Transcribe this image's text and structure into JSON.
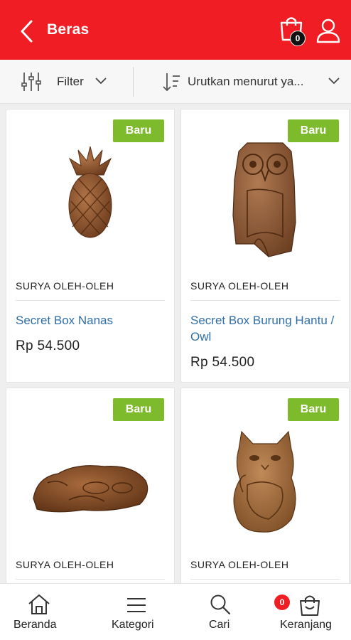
{
  "header": {
    "title": "Beras",
    "cart_count": "0",
    "back_icon": "chevron-left-icon",
    "cart_icon": "shopping-bag-icon",
    "user_icon": "user-icon",
    "bg_color": "#f01e24"
  },
  "toolbar": {
    "filter_label": "Filter",
    "sort_label": "Urutkan menurut ya..."
  },
  "products": [
    {
      "badge": "Baru",
      "vendor": "SURYA OLEH-OLEH",
      "name": "Secret Box Nanas",
      "price": "Rp 54.500",
      "image": "pineapple"
    },
    {
      "badge": "Baru",
      "vendor": "SURYA OLEH-OLEH",
      "name": "Secret Box Burung Hantu / Owl",
      "price": "Rp 54.500",
      "image": "owl"
    },
    {
      "badge": "Baru",
      "vendor": "SURYA OLEH-OLEH",
      "name": "",
      "price": "",
      "image": "dolphin"
    },
    {
      "badge": "Baru",
      "vendor": "SURYA OLEH-OLEH",
      "name": "",
      "price": "",
      "image": "cat"
    }
  ],
  "bottom_nav": {
    "home": "Beranda",
    "categories": "Kategori",
    "search": "Cari",
    "cart": "Keranjang",
    "cart_badge": "0"
  },
  "colors": {
    "accent": "#f01e24",
    "badge_green": "#7dbb2c",
    "link_blue": "#2f6fa8"
  }
}
